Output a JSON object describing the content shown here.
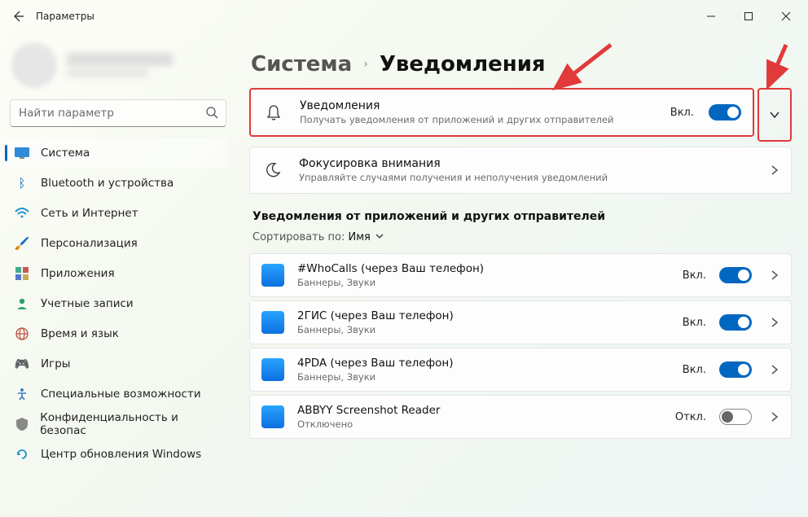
{
  "window": {
    "title": "Параметры"
  },
  "search": {
    "placeholder": "Найти параметр"
  },
  "nav": {
    "items": [
      {
        "label": "Система"
      },
      {
        "label": "Bluetooth и устройства"
      },
      {
        "label": "Сеть и Интернет"
      },
      {
        "label": "Персонализация"
      },
      {
        "label": "Приложения"
      },
      {
        "label": "Учетные записи"
      },
      {
        "label": "Время и язык"
      },
      {
        "label": "Игры"
      },
      {
        "label": "Специальные возможности"
      },
      {
        "label": "Конфиденциальность и безопас"
      },
      {
        "label": "Центр обновления Windows"
      }
    ]
  },
  "breadcrumb": {
    "parent": "Система",
    "sep": "›",
    "current": "Уведомления"
  },
  "cards": {
    "notifications": {
      "title": "Уведомления",
      "sub": "Получать уведомления от приложений и других отправителей",
      "status": "Вкл."
    },
    "focus": {
      "title": "Фокусировка внимания",
      "sub": "Управляйте случаями получения и неполучения уведомлений"
    }
  },
  "appsSection": {
    "title": "Уведомления от приложений и других отправителей",
    "sortLabel": "Сортировать по:",
    "sortValue": "Имя"
  },
  "statuses": {
    "on": "Вкл.",
    "off": "Откл."
  },
  "apps": [
    {
      "title": "#WhoCalls (через Ваш телефон)",
      "sub": "Баннеры, Звуки",
      "status": "Вкл.",
      "on": true
    },
    {
      "title": "2ГИС (через Ваш телефон)",
      "sub": "Баннеры, Звуки",
      "status": "Вкл.",
      "on": true
    },
    {
      "title": "4PDA (через Ваш телефон)",
      "sub": "Баннеры, Звуки",
      "status": "Вкл.",
      "on": true
    },
    {
      "title": "ABBYY Screenshot Reader",
      "sub": "Отключено",
      "status": "Откл.",
      "on": false
    }
  ]
}
